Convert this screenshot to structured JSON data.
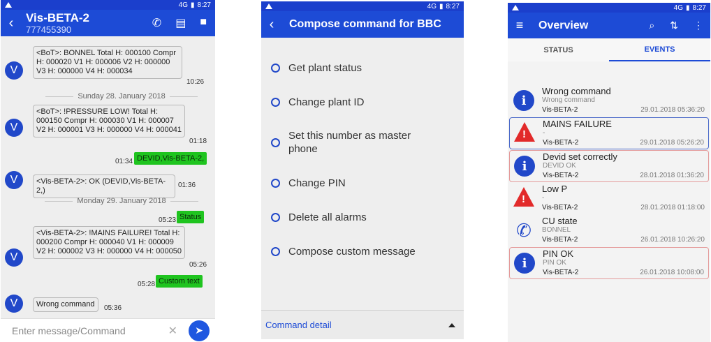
{
  "status": {
    "time": "8:27",
    "net": "4G"
  },
  "chat": {
    "title": "Vis-BETA-2",
    "phone": "777455390",
    "msg1": "<BoT>: BONNEL Total H: 000100 Compr H: 000020 V1 H: 000006 V2 H: 000000 V3 H: 000000 V4 H: 000034",
    "msg1_time": "10:26",
    "day1": "Sunday 28. January 2018",
    "msg2": "<BoT>: !PRESSURE LOW! Total H: 000150 Compr H: 000030 V1 H: 000007 V2 H: 000001 V3 H: 000000 V4 H: 000041",
    "msg2_time": "01:18",
    "out1_time": "01:34",
    "out1": "DEVID,Vis-BETA-2,",
    "msg3": "<Vis-BETA-2>: OK (DEVID,Vis-BETA-2,)",
    "msg3_time": "01:36",
    "day2": "Monday 29. January 2018",
    "out2_time": "05:23",
    "out2": "Status",
    "msg4": "<Vis-BETA-2>: !MAINS FAILURE! Total H: 000200 Compr H: 000040 V1 H: 000009 V2 H: 000002 V3 H: 000000 V4 H: 000050",
    "msg4_time": "05:26",
    "out3_time": "05:28",
    "out3": "Custom text",
    "msg5": "Wrong command",
    "msg5_time": "05:36",
    "avatar": "V",
    "input_placeholder": "Enter message/Command"
  },
  "compose": {
    "title": "Compose command for BBC",
    "options": [
      "Get plant status",
      "Change plant ID",
      "Set this number as master phone",
      "Change PIN",
      "Delete all alarms",
      "Compose custom message"
    ],
    "detail": "Command detail"
  },
  "overview": {
    "title": "Overview",
    "tabs": [
      "STATUS",
      "EVENTS"
    ],
    "events": [
      {
        "title": "Wrong command",
        "sub": "Wrong command",
        "device": "Vis-BETA-2",
        "date": "29.01.2018 05:36:20",
        "icon": "info-icon"
      },
      {
        "title": "MAINS FAILURE",
        "sub": "-",
        "device": "Vis-BETA-2",
        "date": "29.01.2018 05:26:20",
        "icon": "warning-icon"
      },
      {
        "title": "Devid set correctly",
        "sub": "DEVID OK",
        "device": "Vis-BETA-2",
        "date": "28.01.2018 01:36:20",
        "icon": "info-icon"
      },
      {
        "title": "Low P",
        "sub": "-",
        "device": "Vis-BETA-2",
        "date": "28.01.2018 01:18:00",
        "icon": "warning-icon"
      },
      {
        "title": "CU state",
        "sub": "BONNEL",
        "device": "Vis-BETA-2",
        "date": "26.01.2018 10:26:20",
        "icon": "phone-icon"
      },
      {
        "title": "PIN OK",
        "sub": "PIN OK",
        "device": "Vis-BETA-2",
        "date": "26.01.2018 10:08:00",
        "icon": "info-icon"
      }
    ]
  },
  "colors": {
    "primary": "#1d4bd6",
    "outgoing": "#1fc41f",
    "alert": "#e22a2a"
  }
}
